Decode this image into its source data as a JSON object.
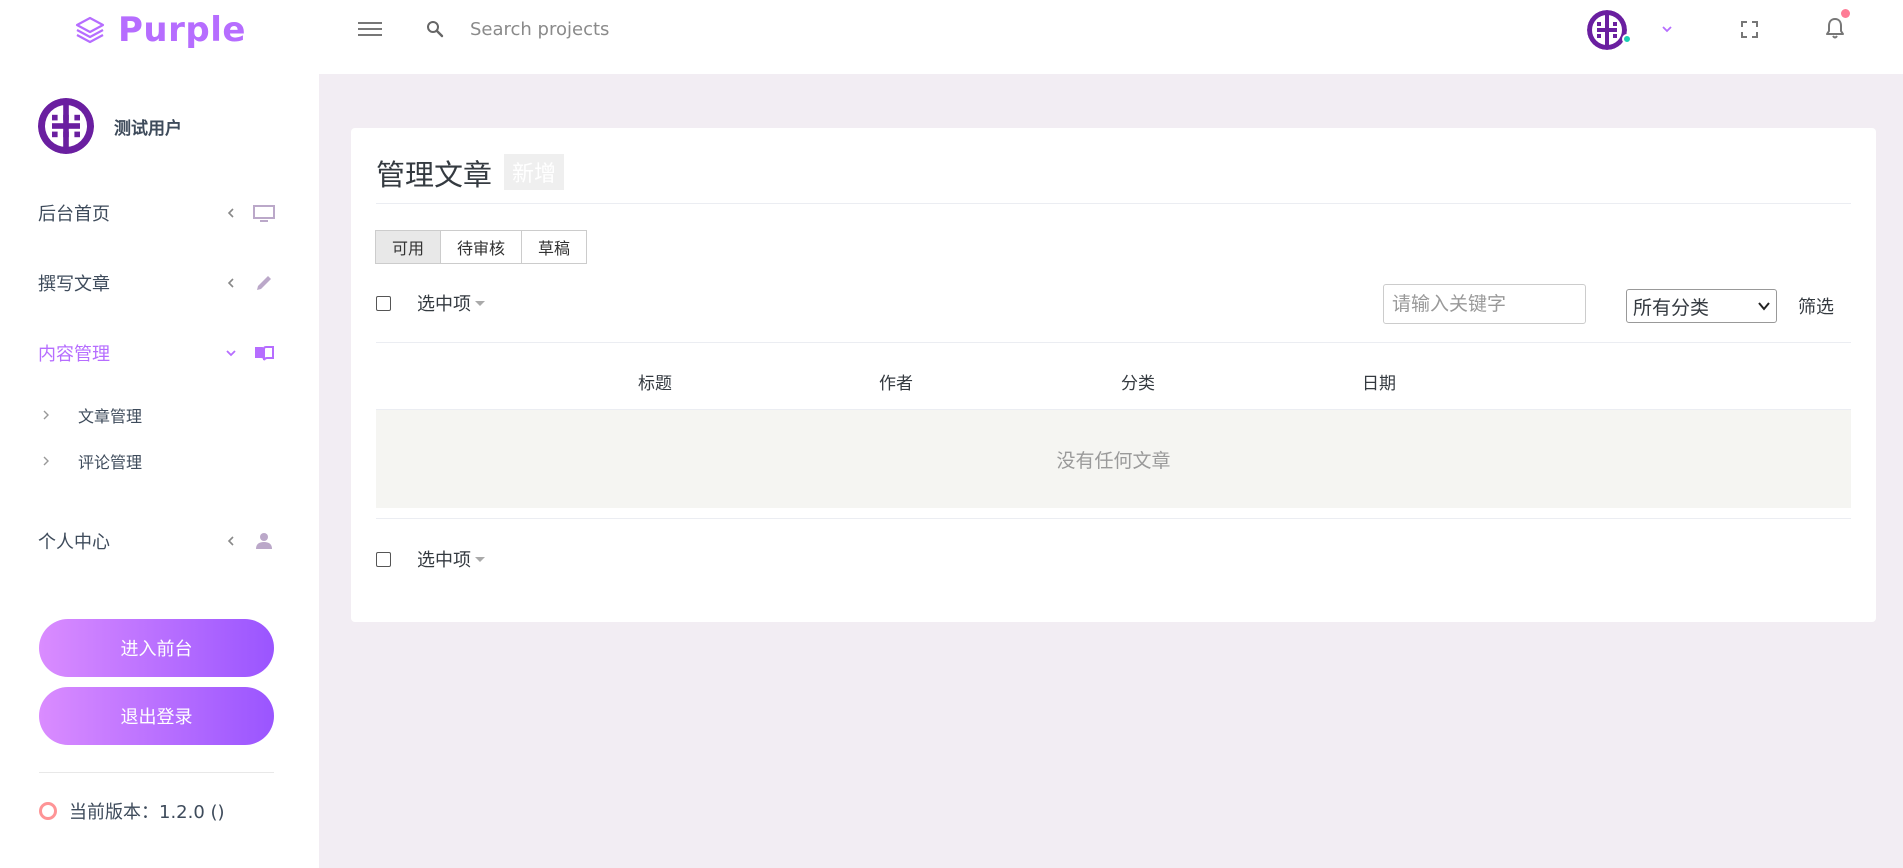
{
  "brand": {
    "name": "Purple",
    "accent": "#b66dff"
  },
  "topbar": {
    "search_placeholder": "Search projects",
    "icons": [
      "menu-icon",
      "search-icon",
      "chevron-down-icon",
      "fullscreen-icon",
      "bell-icon"
    ]
  },
  "sidebar": {
    "username": "测试用户",
    "items": [
      {
        "label": "后台首页",
        "icon": "monitor-icon",
        "state": "collapsed"
      },
      {
        "label": "撰写文章",
        "icon": "pencil-icon",
        "state": "collapsed"
      },
      {
        "label": "内容管理",
        "icon": "book-icon",
        "state": "expanded"
      },
      {
        "label": "个人中心",
        "icon": "user-icon",
        "state": "collapsed"
      }
    ],
    "subitems": [
      {
        "label": "文章管理"
      },
      {
        "label": "评论管理"
      }
    ],
    "frontend_button": "进入前台",
    "logout_button": "退出登录",
    "version": "当前版本：1.2.0 ()"
  },
  "main": {
    "title": "管理文章",
    "new_button": "新增",
    "tabs": [
      {
        "label": "可用",
        "active": true
      },
      {
        "label": "待审核",
        "active": false
      },
      {
        "label": "草稿",
        "active": false
      }
    ],
    "select_label": "选中项",
    "keyword_placeholder": "请输入关键字",
    "category_selected": "所有分类",
    "filter_button": "筛选",
    "columns": [
      "标题",
      "作者",
      "分类",
      "日期"
    ],
    "empty_message": "没有任何文章"
  }
}
